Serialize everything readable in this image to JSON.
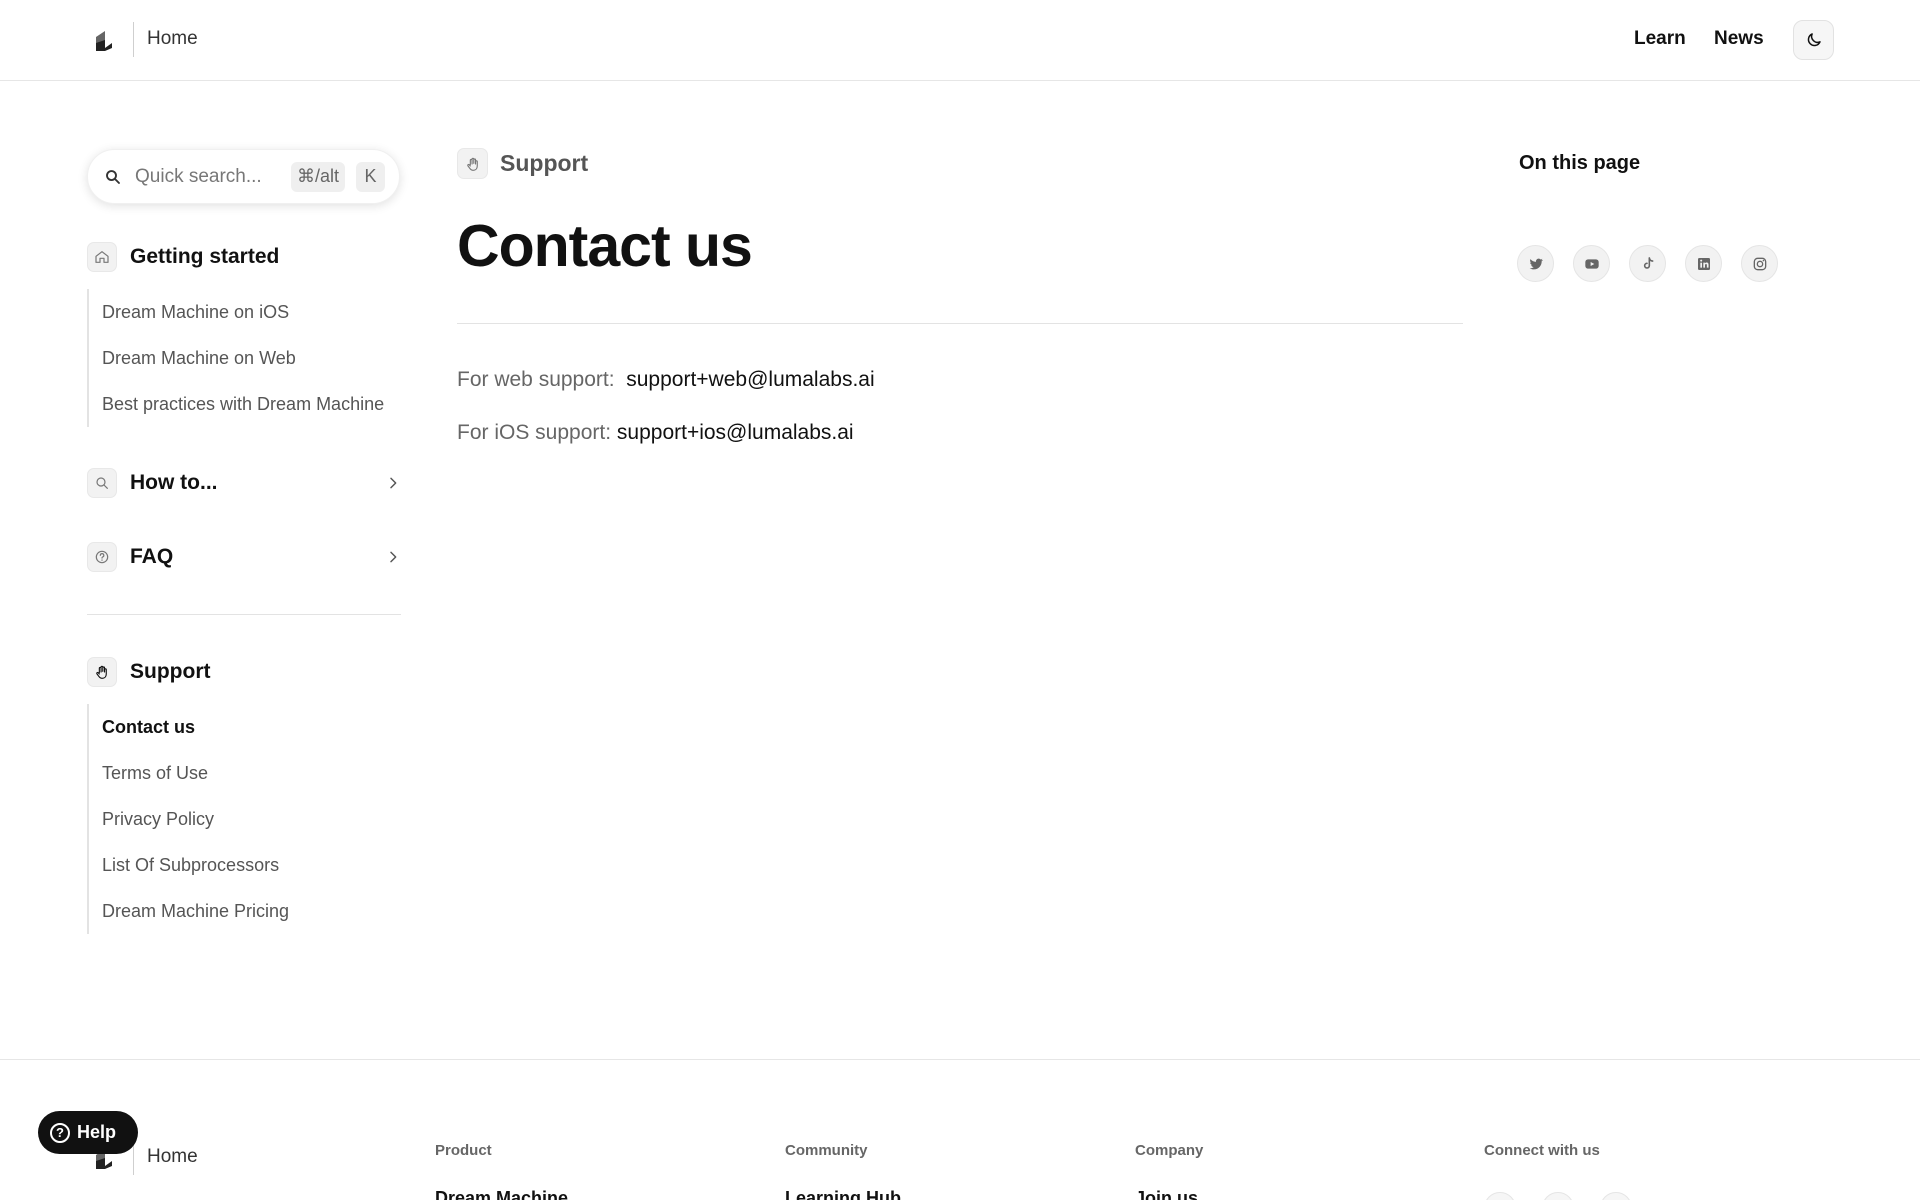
{
  "header": {
    "home_label": "Home",
    "nav": [
      {
        "label": "Learn"
      },
      {
        "label": "News"
      }
    ]
  },
  "sidebar": {
    "search": {
      "placeholder": "Quick search...",
      "shortcut_modifier": "⌘/alt",
      "shortcut_key": "K"
    },
    "sections": [
      {
        "title": "Getting started",
        "icon": "home-icon",
        "items": [
          {
            "label": "Dream Machine on iOS"
          },
          {
            "label": "Dream Machine on Web"
          },
          {
            "label": "Best practices with Dream Machine"
          }
        ]
      },
      {
        "title": "How to...",
        "icon": "search-icon",
        "collapsed": true
      },
      {
        "title": "FAQ",
        "icon": "question-circle-icon",
        "collapsed": true
      },
      {
        "title": "Support",
        "icon": "hand-icon",
        "items": [
          {
            "label": "Contact us",
            "active": true
          },
          {
            "label": "Terms of Use"
          },
          {
            "label": "Privacy Policy"
          },
          {
            "label": "List Of Subprocessors"
          },
          {
            "label": "Dream Machine Pricing"
          }
        ]
      }
    ]
  },
  "main": {
    "breadcrumb": "Support",
    "title": "Contact us",
    "web_support": {
      "label": "For web support:",
      "email": "support+web@lumalabs.ai"
    },
    "ios_support": {
      "label": "For iOS support:",
      "email": "support+ios@lumalabs.ai"
    }
  },
  "right_rail": {
    "heading": "On this page",
    "social": [
      "twitter-icon",
      "youtube-icon",
      "tiktok-icon",
      "linkedin-icon",
      "instagram-icon"
    ]
  },
  "footer": {
    "home_label": "Home",
    "columns": [
      {
        "heading": "Product",
        "first_link": "Dream Machine"
      },
      {
        "heading": "Community",
        "first_link": "Learning Hub"
      },
      {
        "heading": "Company",
        "first_link": "Join us"
      },
      {
        "heading": "Connect with us"
      }
    ]
  },
  "help_button": {
    "label": "Help"
  },
  "colors": {
    "text": "#111111",
    "muted": "#555555",
    "border": "#e3e3e3",
    "chip_bg": "#f2f2f2"
  }
}
